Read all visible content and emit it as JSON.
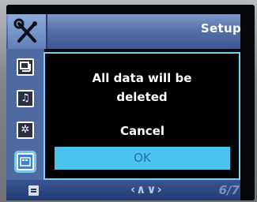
{
  "header": {
    "title": "Setup",
    "icon": "wrench-screwdriver-icon"
  },
  "sidebar": {
    "items": [
      {
        "icon": "gallery-icon",
        "active": false
      },
      {
        "icon": "music-note-icon",
        "active": false
      },
      {
        "icon": "settings-gear-icon",
        "active": false
      },
      {
        "icon": "memory-card-icon",
        "active": true
      }
    ]
  },
  "dialog": {
    "message_line1": "All data will be",
    "message_line2": "deleted",
    "options": [
      "Cancel",
      "OK"
    ],
    "selected": "OK"
  },
  "footer": {
    "icon": "menu-list-icon",
    "nav": "‹∧∨›",
    "page": "6/7"
  },
  "colors": {
    "header": "#5771a8",
    "sidebar": "#4f6aa2",
    "dialog_border": "#78d0f0",
    "selected_option": "#4cc3ef",
    "selected_text": "#1f6fb0"
  }
}
